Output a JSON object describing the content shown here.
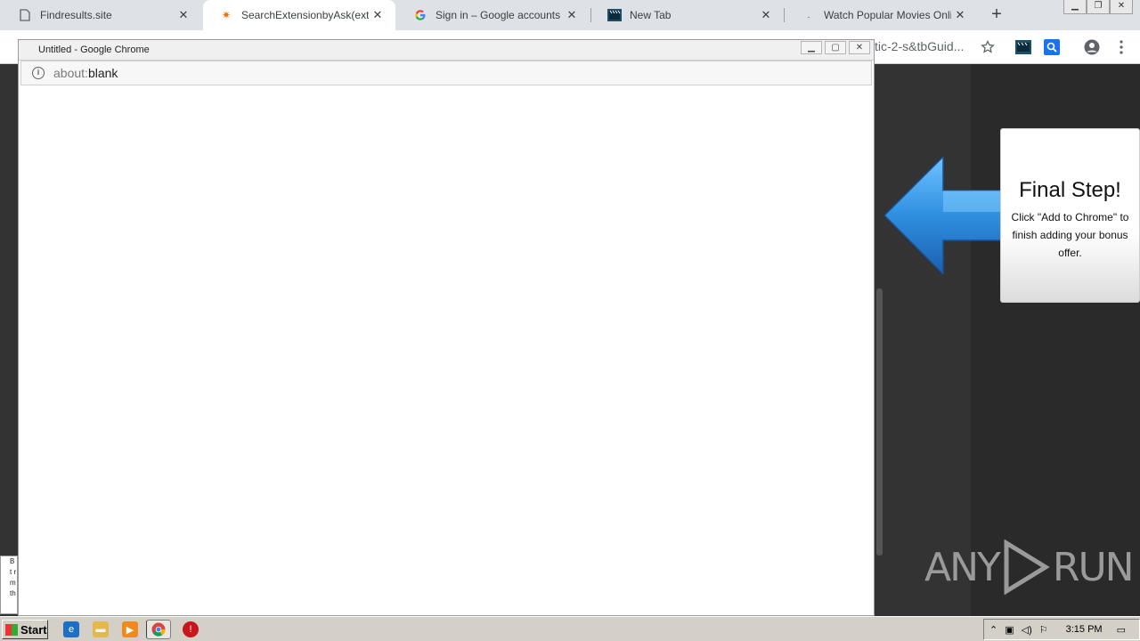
{
  "browser": {
    "tabs": [
      {
        "title": "Findresults.site",
        "icon": "document-icon"
      },
      {
        "title": "SearchExtensionbyAsk(ext)",
        "icon": "spark-icon"
      },
      {
        "title": "Sign in – Google accounts",
        "icon": "google-g-icon"
      },
      {
        "title": "New Tab",
        "icon": "film-icon"
      },
      {
        "title": "Watch Popular Movies Online | F",
        "icon": "dot-icon"
      }
    ],
    "address_fragment": "tic-2-s&tbGuid..."
  },
  "popup": {
    "window_title": "Untitled - Google Chrome",
    "url_scheme": "about:",
    "url_path": "blank"
  },
  "page": {
    "card_title": "Final Step!",
    "card_text": "Click \"Add to Chrome\" to finish adding your bonus offer.",
    "side_note": "B t r m th",
    "watermark_left": "ANY",
    "watermark_right": "RUN"
  },
  "taskbar": {
    "start_label": "Start",
    "clock": "3:15 PM"
  },
  "colors": {
    "arrow_blue": "#2f8fe0",
    "page_dark": "#333333"
  }
}
